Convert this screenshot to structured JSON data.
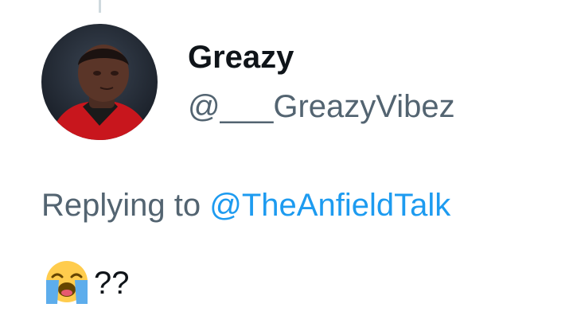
{
  "tweet": {
    "author": {
      "display_name": "Greazy",
      "handle": "@___GreazyVibez",
      "avatar_icon": "profile-avatar"
    },
    "replying_to": {
      "prefix": "Replying to",
      "mention": "@TheAnfieldTalk"
    },
    "body": {
      "emoji_icon": "loudly-crying-face-emoji",
      "text": "??"
    }
  },
  "colors": {
    "primary_text": "#0f1419",
    "secondary_text": "#536471",
    "link": "#1d9bf0",
    "thread_line": "#cfd9de"
  }
}
